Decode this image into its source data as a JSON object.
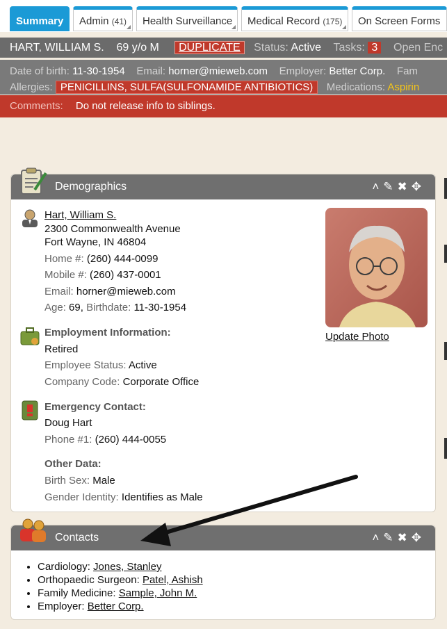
{
  "tabs": [
    {
      "label": "Summary",
      "count": ""
    },
    {
      "label": "Admin",
      "count": "(41)"
    },
    {
      "label": "Health Surveillance",
      "count": ""
    },
    {
      "label": "Medical Record",
      "count": "(175)"
    },
    {
      "label": "On Screen Forms",
      "count": ""
    }
  ],
  "patient": {
    "name": "HART, WILLIAM S.",
    "age_sex": "69 y/o M",
    "duplicate": "DUPLICATE",
    "status_label": "Status:",
    "status": "Active",
    "tasks_label": "Tasks:",
    "tasks": "3",
    "open_enc": "Open Enc",
    "dob_label": "Date of birth:",
    "dob": "11-30-1954",
    "email_label": "Email:",
    "email": "horner@mieweb.com",
    "employer_label": "Employer:",
    "employer": "Better Corp.",
    "fam_label": "Fam",
    "allergies_label": "Allergies:",
    "allergies": "PENICILLINS, SULFA(SULFONAMIDE ANTIBIOTICS)",
    "medications_label": "Medications:",
    "medications": "Aspirin",
    "comments_label": "Comments:",
    "comments": "Do not release info to siblings."
  },
  "demographics": {
    "title": "Demographics",
    "name": "Hart, William S.",
    "address1": "2300 Commonwealth Avenue",
    "address2": "Fort Wayne, IN 46804",
    "home_label": "Home #:",
    "home": "(260) 444-0099",
    "mobile_label": "Mobile #:",
    "mobile": "(260) 437-0001",
    "email_label": "Email:",
    "email": "horner@mieweb.com",
    "age_label": "Age:",
    "age": "69,",
    "birthdate_label": "Birthdate:",
    "birthdate": "11-30-1954",
    "update_photo": "Update Photo",
    "employment_heading": "Employment Information:",
    "employment": "Retired",
    "emp_status_label": "Employee Status:",
    "emp_status": "Active",
    "company_label": "Company Code:",
    "company": "Corporate Office",
    "emergency_heading": "Emergency Contact:",
    "emergency_name": "Doug Hart",
    "phone1_label": "Phone #1:",
    "phone1": "(260) 444-0055",
    "other_heading": "Other Data:",
    "birth_sex_label": "Birth Sex:",
    "birth_sex": "Male",
    "gender_label": "Gender Identity:",
    "gender": "Identifies as Male"
  },
  "contacts": {
    "title": "Contacts",
    "items": [
      {
        "role": "Cardiology:",
        "name": "Jones, Stanley"
      },
      {
        "role": "Orthopaedic Surgeon:",
        "name": "Patel, Ashish"
      },
      {
        "role": "Family Medicine:",
        "name": "Sample, John M."
      },
      {
        "role": "Employer:",
        "name": "Better Corp."
      }
    ]
  },
  "panel_icons": [
    "chevron-up-icon",
    "pencil-icon",
    "close-icon",
    "move-icon"
  ],
  "colors": {
    "accent": "#1b9ad6",
    "alert_red": "#c0392b",
    "header_gray": "#6b6b6b"
  }
}
